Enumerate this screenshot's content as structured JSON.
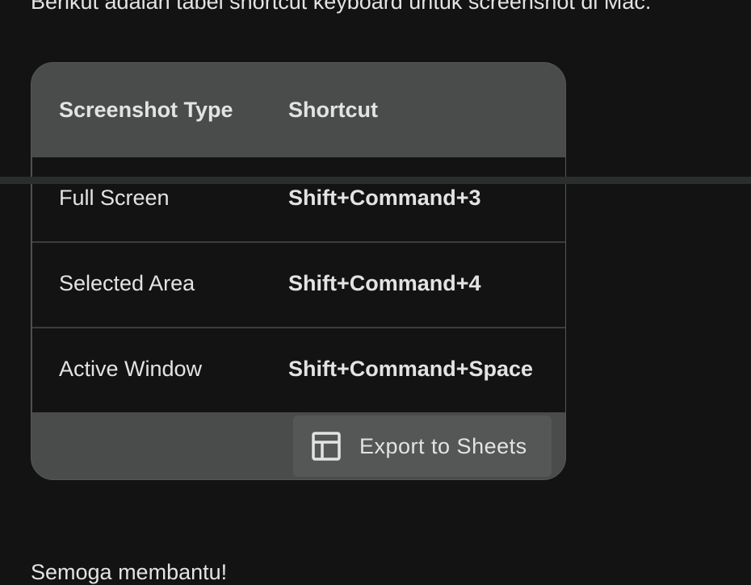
{
  "message": {
    "intro_text": "Berikut adalah tabel shortcut keyboard untuk screenshot di Mac:",
    "outro_text": "Semoga membantu!"
  },
  "table": {
    "headers": [
      "Screenshot Type",
      "Shortcut"
    ],
    "rows": [
      [
        "Full Screen",
        "Shift+Command+3"
      ],
      [
        "Selected Area",
        "Shift+Command+4"
      ],
      [
        "Active Window",
        "Shift+Command+Space"
      ]
    ]
  },
  "actions": {
    "export_label": "Export to Sheets",
    "export_icon": "table-icon"
  },
  "colors": {
    "background": "#131313",
    "table_surface": "#4a4c4b",
    "button_surface": "#555756",
    "text": "#e3e3e3"
  }
}
